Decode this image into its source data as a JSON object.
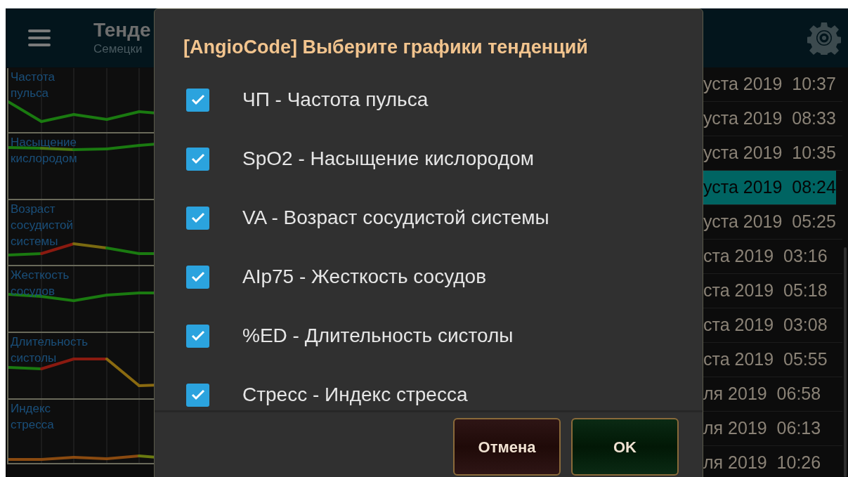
{
  "app_bar": {
    "title": "Тенде",
    "subtitle": "Семецки"
  },
  "trend_charts": [
    {
      "label": "Частота\nпульса"
    },
    {
      "label": "Насыщение\nкислородом"
    },
    {
      "label": "Возраст\nсосудистой\nсистемы"
    },
    {
      "label": "Жесткость\nсосудов"
    },
    {
      "label": "Длительность\nсистолы"
    },
    {
      "label": "Индекс\nстресса"
    }
  ],
  "history": [
    {
      "text": "уста 2019  10:37",
      "selected": false
    },
    {
      "text": "уста 2019  08:33",
      "selected": false
    },
    {
      "text": "уста 2019  10:35",
      "selected": false
    },
    {
      "text": "уста 2019  08:24",
      "selected": true
    },
    {
      "text": "уста 2019  05:25",
      "selected": false
    },
    {
      "text": "ста 2019  03:16",
      "selected": false
    },
    {
      "text": "ста 2019  05:18",
      "selected": false
    },
    {
      "text": "ста 2019  03:08",
      "selected": false
    },
    {
      "text": "ста 2019  05:55",
      "selected": false
    },
    {
      "text": "ля 2019  06:58",
      "selected": false
    },
    {
      "text": "ля 2019  06:13",
      "selected": false
    },
    {
      "text": "ля 2019  10:26",
      "selected": false
    }
  ],
  "dialog": {
    "title": "[AngioCode] Выберите графики тенденций",
    "options": [
      {
        "label": "ЧП - Частота пульса",
        "checked": true
      },
      {
        "label": "SpO2 - Насыщение кислородом",
        "checked": true
      },
      {
        "label": "VA - Возраст сосудистой системы",
        "checked": true
      },
      {
        "label": "AIp75 - Жесткость сосудов",
        "checked": true
      },
      {
        "label": "%ED - Длительность систолы",
        "checked": true
      },
      {
        "label": "Стресс - Индекс стресса",
        "checked": true
      }
    ],
    "buttons": [
      {
        "label": "Отмена",
        "kind": "cancel"
      },
      {
        "label": "OK",
        "kind": "ok"
      }
    ]
  }
}
